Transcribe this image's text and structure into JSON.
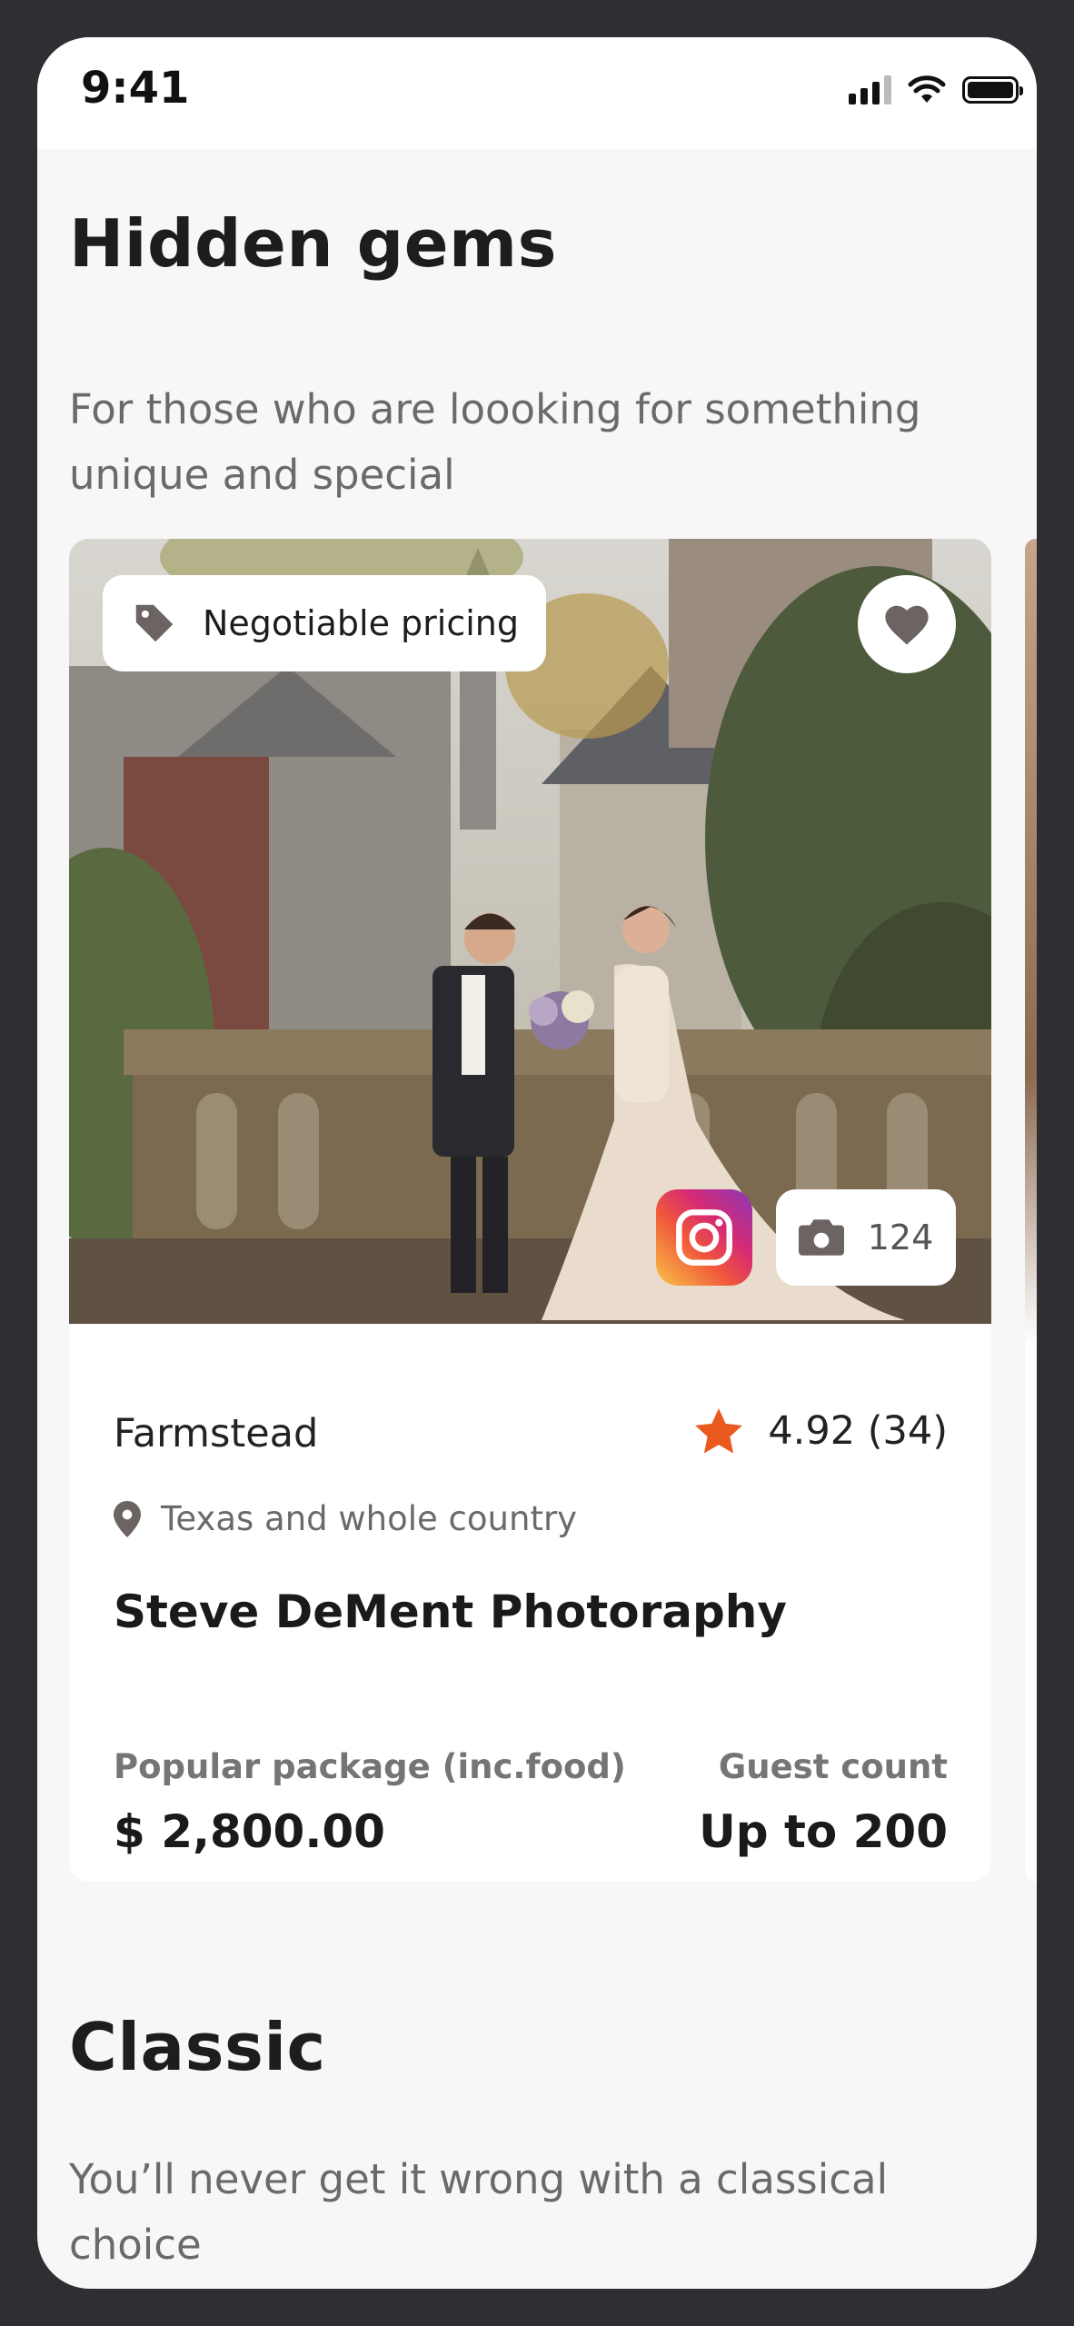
{
  "status_bar": {
    "time": "9:41"
  },
  "sections": [
    {
      "title": "Hidden gems",
      "subtitle": "For those who are loooking for something unique and special"
    },
    {
      "title": "Classic",
      "subtitle": "You’ll never get it wrong with a classical choice"
    }
  ],
  "card": {
    "badge": "Negotiable pricing",
    "photo_count": "124",
    "category": "Farmstead",
    "rating": "4.92 (34)",
    "location": "Texas and whole country",
    "vendor_name": "Steve DeMent Photoraphy",
    "package_label": "Popular package (inc.food)",
    "package_price": "$ 2,800.00",
    "guest_label": "Guest count",
    "guest_value": "Up to 200"
  },
  "colors": {
    "accent_star": "#ea5a1f",
    "icon_grey": "#6b6462",
    "background": "#f7f7f7"
  },
  "icons": [
    "tag-icon",
    "heart-icon",
    "instagram-icon",
    "camera-icon",
    "star-icon",
    "location-pin-icon",
    "signal-icon",
    "wifi-icon",
    "battery-icon"
  ]
}
